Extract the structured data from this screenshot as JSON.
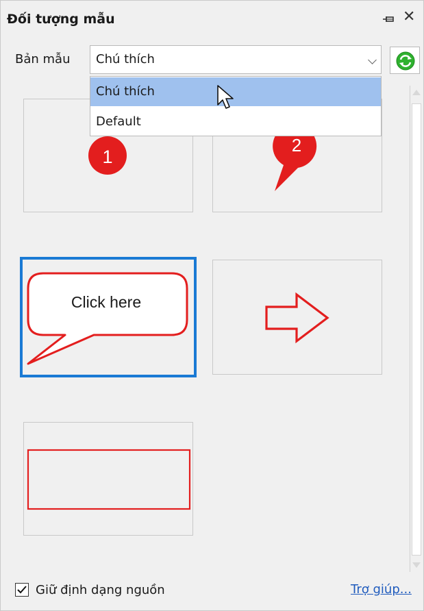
{
  "panel": {
    "title": "Đối tượng mẫu"
  },
  "toolbar": {
    "template_label": "Bản mẫu",
    "selected_value": "Chú thích"
  },
  "dropdown": {
    "options": [
      "Chú thích",
      "Default"
    ],
    "selected_index": 0
  },
  "tiles": [
    {
      "name": "numbered-circle-callout",
      "text": "1"
    },
    {
      "name": "pin-callout",
      "text": "2"
    },
    {
      "name": "speech-bubble-callout",
      "text": "Click here",
      "selected": true
    },
    {
      "name": "arrow-shape"
    },
    {
      "name": "rectangle-shape"
    }
  ],
  "footer": {
    "keep_format_label": "Giữ định dạng nguồn",
    "keep_format_checked": true,
    "help_label": "Trợ giúp..."
  },
  "icons": [
    "pin-icon",
    "close-icon",
    "chevron-down-icon",
    "refresh-icon",
    "cursor-icon",
    "checkmark-icon"
  ],
  "colors": {
    "accent_selected": "#1a7ad4",
    "highlight": "#9fc1ee",
    "shape_red": "#e31e1e",
    "link": "#1f5bbd",
    "refresh_green": "#2fb12f"
  }
}
